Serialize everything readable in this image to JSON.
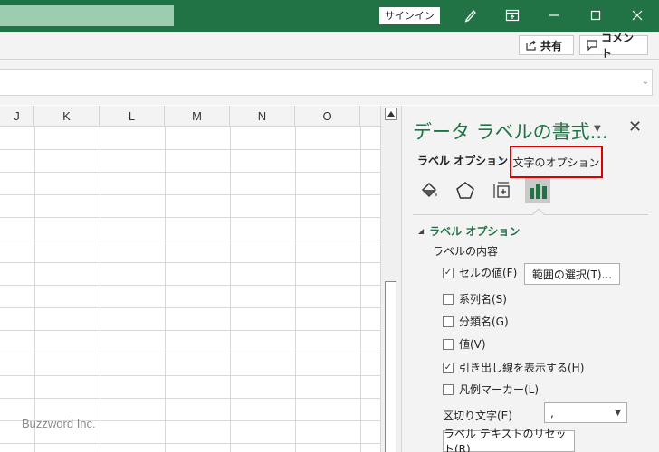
{
  "titlebar": {
    "signin_label": "サインイン",
    "colors": {
      "bar": "#217346",
      "search": "#9ccdb0"
    },
    "icons": [
      "pen-icon",
      "ribbon-display-icon",
      "minimize-icon",
      "maximize-icon",
      "close-icon"
    ]
  },
  "ribbon": {
    "share_label": "共有",
    "comment_label": "コメント"
  },
  "grid": {
    "columns": [
      "J",
      "K",
      "L",
      "M",
      "N",
      "O"
    ],
    "watermark": "Buzzword Inc."
  },
  "pane": {
    "title": "データ ラベルの書式...",
    "tab_label_options": "ラベル オプション",
    "tab_text_options": "文字のオプション",
    "category_icons": [
      "fill-line-icon",
      "effects-icon",
      "size-properties-icon",
      "label-options-icon"
    ],
    "section_title": "ラベル オプション",
    "subsection_title": "ラベルの内容",
    "options": [
      {
        "label": "セルの値(F)",
        "checked": true
      },
      {
        "label": "系列名(S)",
        "checked": false
      },
      {
        "label": "分類名(G)",
        "checked": false
      },
      {
        "label": "値(V)",
        "checked": false
      },
      {
        "label": "引き出し線を表示する(H)",
        "checked": true
      },
      {
        "label": "凡例マーカー(L)",
        "checked": false
      }
    ],
    "range_button": "範囲の選択(T)...",
    "separator_label": "区切り文字(E)",
    "separator_value": ",",
    "reset_button": "ラベル テキストのリセット(R)",
    "highlight_color": "#dd0000"
  }
}
